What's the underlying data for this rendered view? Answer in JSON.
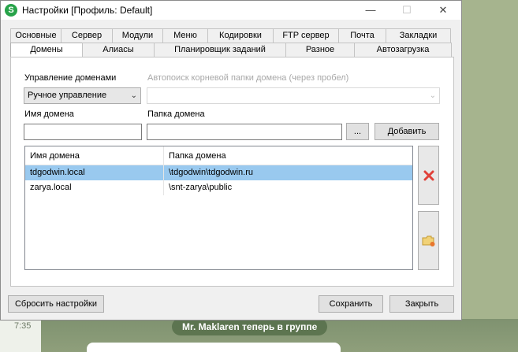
{
  "background": {
    "time": "7:35",
    "notification": "Mr. Maklaren теперь в группе"
  },
  "window": {
    "icon_letter": "S",
    "title": "Настройки [Профиль: Default]",
    "controls": {
      "minimize": "—",
      "maximize": "☐",
      "close": "✕"
    }
  },
  "tabs_row1": [
    "Основные",
    "Сервер",
    "Модули",
    "Меню",
    "Кодировки",
    "FTP сервер",
    "Почта",
    "Закладки"
  ],
  "tabs_row2": [
    "Домены",
    "Алиасы",
    "Планировщик заданий",
    "Разное",
    "Автозагрузка"
  ],
  "active_tab": "Домены",
  "domains": {
    "management_label": "Управление доменами",
    "management_value": "Ручное управление",
    "autosearch_label": "Автопоиск корневой папки домена (через пробел)",
    "autosearch_value": "",
    "domain_name_label": "Имя домена",
    "domain_name_value": "",
    "domain_folder_label": "Папка домена",
    "domain_folder_value": "",
    "browse_label": "...",
    "add_label": "Добавить",
    "table": {
      "columns": [
        "Имя домена",
        "Папка домена"
      ],
      "rows": [
        {
          "name": "tdgodwin.local",
          "folder": "\\tdgodwin\\tdgodwin.ru",
          "selected": true
        },
        {
          "name": "zarya.local",
          "folder": "\\snt-zarya\\public",
          "selected": false
        }
      ]
    },
    "delete_icon": "red-x-icon",
    "folder_icon": "folder-add-icon"
  },
  "footer": {
    "reset_label": "Сбросить настройки",
    "save_label": "Сохранить",
    "close_label": "Закрыть"
  },
  "colors": {
    "selection": "#99c9ef",
    "app_icon": "#27a349",
    "delete": "#e0413a"
  }
}
